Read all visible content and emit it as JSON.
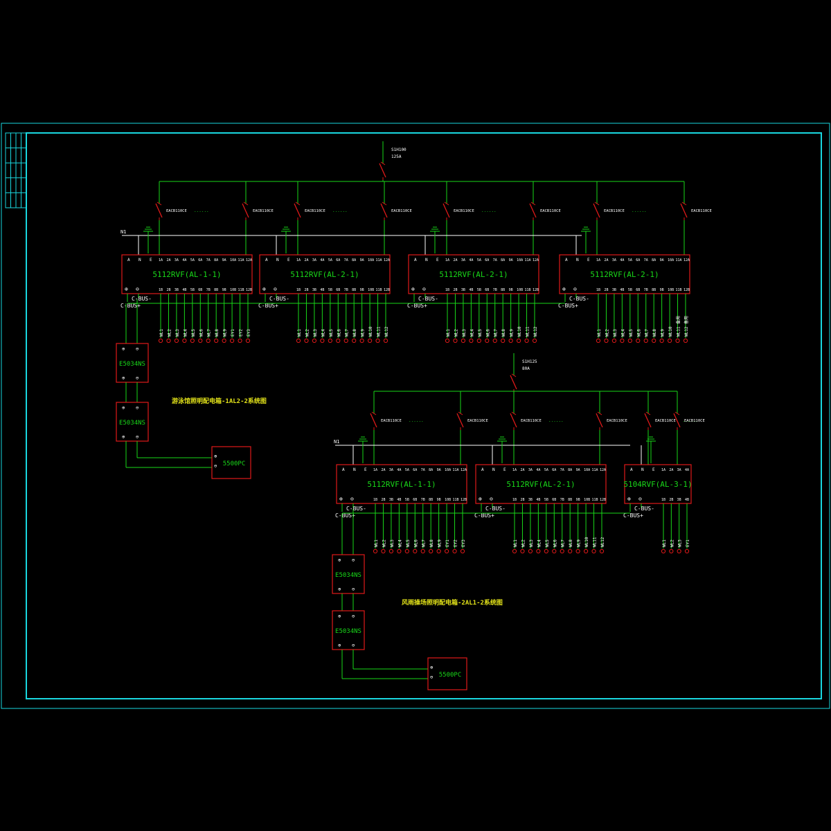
{
  "colors": {
    "background": "#000000",
    "frame": "#19d8e0",
    "wire": "#19d819",
    "device": "#e01919",
    "label": "#ffffff",
    "module_title": "#19d819",
    "caption": "#e0e019"
  },
  "upper_system": {
    "caption": "游泳馆照明配电箱-1AL2-2系统图",
    "main_breaker": "S1H100",
    "main_breaker_rating": "125A",
    "n_label": "N1",
    "breakers": [
      {
        "label": "EACB110CE",
        "dots": "......"
      },
      {
        "label": "EACB110CE",
        "dots": ""
      },
      {
        "label": "EACB110CE",
        "dots": "......"
      },
      {
        "label": "EACB110CE",
        "dots": ""
      },
      {
        "label": "EACB110CE",
        "dots": "......"
      },
      {
        "label": "EACB110CE",
        "dots": ""
      },
      {
        "label": "EACB110CE",
        "dots": "......"
      },
      {
        "label": "EACB110CE",
        "dots": ""
      }
    ],
    "modules": [
      {
        "name": "5112RVF(AL-1-1)",
        "outputs": [
          "WL1",
          "WL2",
          "WL3",
          "WL4",
          "WL5",
          "WL6",
          "WL7",
          "WL8",
          "WL9",
          "EY1",
          "EY2",
          "EY3"
        ]
      },
      {
        "name": "5112RVF(AL-2-1)",
        "outputs": [
          "WL1",
          "WL2",
          "WL3",
          "WL4",
          "WL5",
          "WL6",
          "WL7",
          "WL8",
          "WL9",
          "WL10",
          "WL11",
          "WL12"
        ]
      },
      {
        "name": "5112RVF(AL-2-1)",
        "outputs": [
          "WL1",
          "WL2",
          "WL3",
          "WL4",
          "WL5",
          "WL6",
          "WL7",
          "WL8",
          "WL9",
          "WL10",
          "WL11",
          "WL12"
        ]
      },
      {
        "name": "5112RVF(AL-2-1)",
        "outputs": [
          "WL1",
          "WL2",
          "WL3",
          "WL4",
          "WL5",
          "WL6",
          "WL7",
          "WL8",
          "WL9",
          "WL10",
          "WL11 备用",
          "WL12 备用"
        ]
      }
    ],
    "bus_minus": "C-BUS-",
    "bus_plus": "C-BUS+",
    "couplers": [
      "E5034NS",
      "E5034NS"
    ],
    "pc": "5500PC"
  },
  "lower_system": {
    "caption": "风雨操场照明配电箱-2AL1-2系统图",
    "main_breaker": "S1H125",
    "main_breaker_rating": "80A",
    "n_label": "N1",
    "breakers": [
      {
        "label": "EACB110CE",
        "dots": "......"
      },
      {
        "label": "EACB110CE",
        "dots": ""
      },
      {
        "label": "EACB110CE",
        "dots": "......"
      },
      {
        "label": "EACB110CE",
        "dots": ""
      },
      {
        "label": "EACB110CE",
        "dots": "......"
      },
      {
        "label": "EACB110CE",
        "dots": ""
      }
    ],
    "modules": [
      {
        "name": "5112RVF(AL-1-1)",
        "outputs": [
          "WL1",
          "WL2",
          "WL3",
          "WL4",
          "WL5",
          "WL6",
          "WL7",
          "WL8",
          "WL9",
          "EY1",
          "EY2",
          "EY3"
        ]
      },
      {
        "name": "5112RVF(AL-2-1)",
        "outputs": [
          "WL1",
          "WL2",
          "WL3",
          "WL4",
          "WL5",
          "WL6",
          "WL7",
          "WL8",
          "WL9",
          "WL10",
          "WL11",
          "WL12"
        ]
      },
      {
        "name": "5104RVF(AL-3-1)",
        "outputs": [
          "WL1",
          "WL2",
          "WL3",
          "EY1"
        ]
      }
    ],
    "bus_minus": "C-BUS-",
    "bus_plus": "C-BUS+",
    "couplers": [
      "E5034NS",
      "E5034NS"
    ],
    "pc": "5500PC"
  },
  "terminals": {
    "power": [
      "A",
      "N",
      "E"
    ],
    "bus": [
      "⊕",
      "⊖"
    ]
  }
}
